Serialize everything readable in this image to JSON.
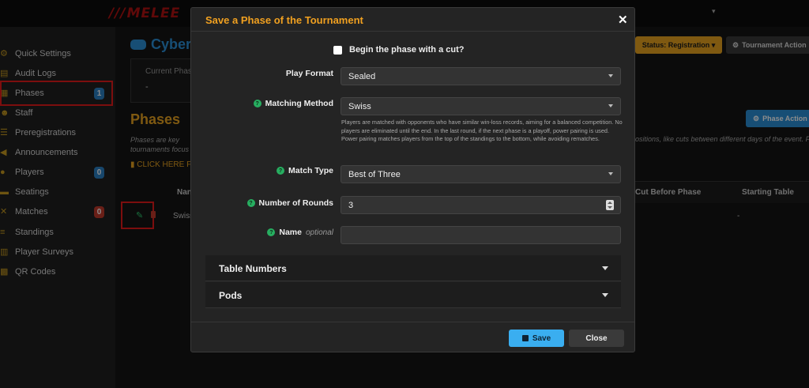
{
  "app": {
    "logo": "MELEE"
  },
  "sidebar": {
    "items": [
      {
        "label": "Quick Settings",
        "icon": "gear-icon"
      },
      {
        "label": "Audit Logs",
        "icon": "ledger-icon"
      },
      {
        "label": "Phases",
        "icon": "clipboard-icon",
        "badge": "1"
      },
      {
        "label": "Staff",
        "icon": "users-icon"
      },
      {
        "label": "Preregistrations",
        "icon": "list-icon"
      },
      {
        "label": "Announcements",
        "icon": "megaphone-icon"
      },
      {
        "label": "Players",
        "icon": "user-icon",
        "badge": "0"
      },
      {
        "label": "Seatings",
        "icon": "chair-icon"
      },
      {
        "label": "Matches",
        "icon": "swords-icon",
        "badge": "0"
      },
      {
        "label": "Standings",
        "icon": "list-ol-icon"
      },
      {
        "label": "Player Surveys",
        "icon": "poll-icon"
      },
      {
        "label": "QR Codes",
        "icon": "qrcode-icon"
      }
    ]
  },
  "page": {
    "title": "Cyber",
    "current_phase_label": "Current Phas",
    "current_phase_value": "-",
    "phases_heading": "Phases",
    "phases_note": "Phases are key tournaments focus",
    "phases_note_right": "ositions, like cuts between different days of the event. Fo",
    "click_here": "CLICK HERE F",
    "status_button": "Status: Registration",
    "tournament_action_button": "Tournament Action",
    "phase_action_button": "Phase Action",
    "table": {
      "col_name": "Nan",
      "col_cut": "Cut Before Phase",
      "col_start": "Starting Table",
      "row_name": "Swiss",
      "row_start": "-"
    }
  },
  "modal": {
    "title": "Save a Phase of the Tournament",
    "cut_label": "Begin the phase with a cut?",
    "play_format_label": "Play Format",
    "play_format_value": "Sealed",
    "matching_method_label": "Matching Method",
    "matching_method_value": "Swiss",
    "matching_help": "Players are matched with opponents who have similar win-loss records, aiming for a balanced competition. No players are eliminated until the end. In the last round, if the next phase is a playoff, power pairing is used. Power pairing matches players from the top of the standings to the bottom, while avoiding rematches.",
    "match_type_label": "Match Type",
    "match_type_value": "Best of Three",
    "rounds_label": "Number of Rounds",
    "rounds_value": "3",
    "name_label": "Name",
    "name_optional": "optional",
    "name_value": "",
    "section_table_numbers": "Table Numbers",
    "section_pods": "Pods",
    "save_button": "Save",
    "close_button": "Close"
  },
  "colors": {
    "accent_orange": "#f0a020",
    "accent_blue": "#3aaef0",
    "highlight_red": "#e21b1b",
    "help_green": "#27ae60"
  }
}
